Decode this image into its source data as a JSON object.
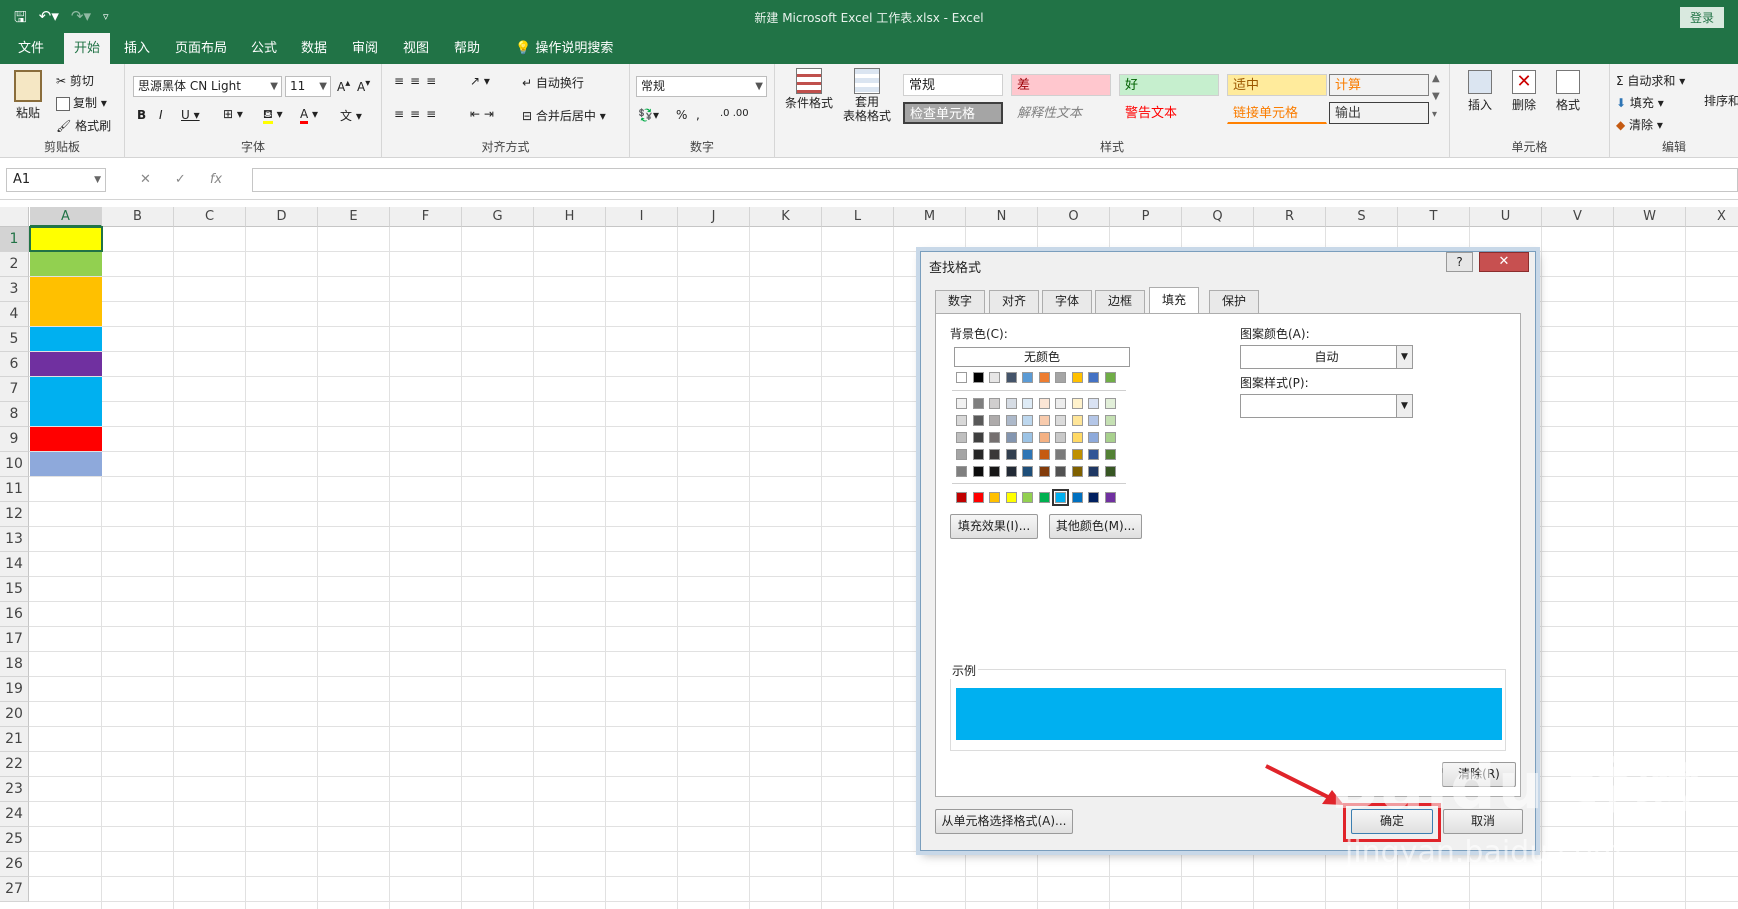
{
  "window": {
    "title": "新建 Microsoft Excel 工作表.xlsx  -  Excel",
    "login": "登录"
  },
  "menu": {
    "tabs": [
      "文件",
      "开始",
      "插入",
      "页面布局",
      "公式",
      "数据",
      "审阅",
      "视图",
      "帮助",
      "操作说明搜索"
    ],
    "active": "开始"
  },
  "ribbon": {
    "clipboard": {
      "paste": "粘贴",
      "cut": "剪切",
      "copy": "复制",
      "painter": "格式刷",
      "label": "剪贴板"
    },
    "font": {
      "name": "思源黑体 CN Light",
      "size": "11",
      "label": "字体"
    },
    "alignment": {
      "wrap": "自动换行",
      "merge": "合并后居中",
      "label": "对齐方式"
    },
    "number": {
      "format": "常规",
      "label": "数字"
    },
    "styles": {
      "conditional": "条件格式",
      "table_format_1": "套用",
      "table_format_2": "表格格式",
      "cells": [
        "常规",
        "差",
        "好",
        "适中",
        "计算",
        "检查单元格",
        "解释性文本",
        "警告文本",
        "链接单元格",
        "输出"
      ],
      "label": "样式"
    },
    "cells": {
      "insert": "插入",
      "delete": "删除",
      "format": "格式",
      "label": "单元格"
    },
    "editing": {
      "autosum": "自动求和",
      "fill": "填充",
      "clear": "清除",
      "sort": "排序和",
      "label": "编辑"
    }
  },
  "formula_bar": {
    "name_box": "A1",
    "fx": "fx"
  },
  "grid": {
    "columns": [
      "A",
      "B",
      "C",
      "D",
      "E",
      "F",
      "G",
      "H",
      "I",
      "J",
      "K",
      "L",
      "M",
      "N",
      "O",
      "P",
      "Q",
      "R",
      "S",
      "T",
      "U",
      "V",
      "W",
      "X"
    ],
    "rows": [
      "1",
      "2",
      "3",
      "4",
      "5",
      "6",
      "7",
      "8",
      "9",
      "10",
      "11",
      "12",
      "13",
      "14",
      "15",
      "16",
      "17",
      "18",
      "19",
      "20",
      "21",
      "22",
      "23",
      "24",
      "25",
      "26",
      "27"
    ],
    "fills": [
      {
        "rows": "1",
        "color": "#FFFF00"
      },
      {
        "rows": "2",
        "color": "#92D050"
      },
      {
        "rows": "3-4",
        "color": "#FFC000"
      },
      {
        "rows": "5",
        "color": "#00B0F0"
      },
      {
        "rows": "6",
        "color": "#7030A0"
      },
      {
        "rows": "7-8",
        "color": "#00B0F0"
      },
      {
        "rows": "9",
        "color": "#FF0000"
      },
      {
        "rows": "10",
        "color": "#8EA9DB"
      }
    ]
  },
  "dialog": {
    "title": "查找格式",
    "help": "?",
    "close": "✕",
    "tabs": [
      "数字",
      "对齐",
      "字体",
      "边框",
      "填充",
      "保护"
    ],
    "active_tab": "填充",
    "background_label": "背景色(C):",
    "no_color": "无颜色",
    "pattern_color_label": "图案颜色(A):",
    "pattern_color_value": "自动",
    "pattern_style_label": "图案样式(P):",
    "fill_effects": "填充效果(I)...",
    "more_colors": "其他颜色(M)...",
    "sample_label": "示例",
    "sample_color": "#00B0F0",
    "clear": "清除(R)",
    "from_cell": "从单元格选择格式(A)...",
    "ok": "确定",
    "cancel": "取消",
    "theme_colors_top": [
      "#FFFFFF",
      "#000000",
      "#E7E6E6",
      "#44546A",
      "#5B9BD5",
      "#ED7D31",
      "#A5A5A5",
      "#FFC000",
      "#4472C4",
      "#70AD47"
    ],
    "theme_shades": [
      [
        "#F2F2F2",
        "#7F7F7F",
        "#D0CECE",
        "#D6DCE4",
        "#DEEBF6",
        "#FBE5D5",
        "#EDEDED",
        "#FFF2CC",
        "#D9E2F3",
        "#E2EFD9"
      ],
      [
        "#D8D8D8",
        "#595959",
        "#AEABAB",
        "#ADB9CA",
        "#BDD7EE",
        "#F8CBAD",
        "#DBDBDB",
        "#FEE599",
        "#B4C6E7",
        "#C5E0B3"
      ],
      [
        "#BFBFBF",
        "#3F3F3F",
        "#757070",
        "#8496B0",
        "#9CC3E5",
        "#F4B183",
        "#C9C9C9",
        "#FFD965",
        "#8EAADB",
        "#A8D08D"
      ],
      [
        "#A5A5A5",
        "#262626",
        "#3A3838",
        "#323F4F",
        "#2E75B5",
        "#C55A11",
        "#7B7B7B",
        "#BF9000",
        "#2F5496",
        "#538135"
      ],
      [
        "#7F7F7F",
        "#0C0C0C",
        "#171616",
        "#222A35",
        "#1E4E79",
        "#833C0B",
        "#525252",
        "#7F6000",
        "#1F3864",
        "#375623"
      ]
    ],
    "standard_colors": [
      "#C00000",
      "#FF0000",
      "#FFC000",
      "#FFFF00",
      "#92D050",
      "#00B050",
      "#00B0F0",
      "#0070C0",
      "#002060",
      "#7030A0"
    ],
    "selected_standard": 6
  },
  "watermark": {
    "brand": "Baidu 经验",
    "url": "jingyan.baidu.com"
  }
}
